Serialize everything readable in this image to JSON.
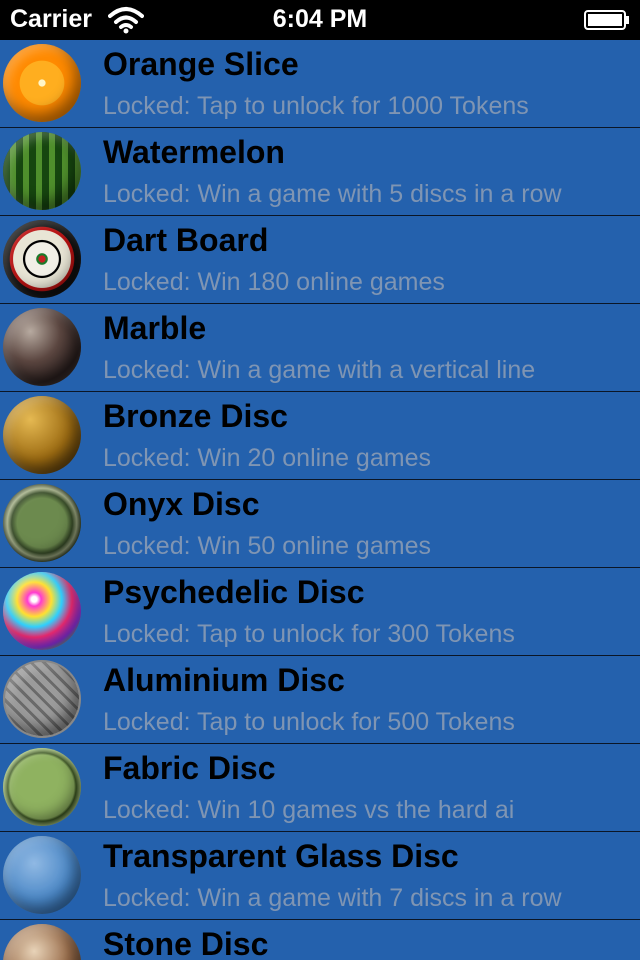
{
  "status_bar": {
    "carrier": "Carrier",
    "time": "6:04 PM",
    "wifi_icon": "wifi-icon",
    "battery_icon": "battery-icon"
  },
  "items": [
    {
      "title": "Orange Slice",
      "subtitle": "Locked: Tap to unlock for 1000 Tokens",
      "icon": "orange-slice-icon"
    },
    {
      "title": "Watermelon",
      "subtitle": "Locked: Win a game with 5 discs in a row",
      "icon": "watermelon-icon"
    },
    {
      "title": "Dart Board",
      "subtitle": "Locked: Win 180 online games",
      "icon": "dart-board-icon"
    },
    {
      "title": "Marble",
      "subtitle": "Locked: Win a game with a vertical line",
      "icon": "marble-icon"
    },
    {
      "title": "Bronze Disc",
      "subtitle": "Locked: Win 20 online games",
      "icon": "bronze-disc-icon"
    },
    {
      "title": "Onyx Disc",
      "subtitle": "Locked: Win 50 online games",
      "icon": "onyx-disc-icon"
    },
    {
      "title": "Psychedelic Disc",
      "subtitle": "Locked: Tap to unlock for 300 Tokens",
      "icon": "psychedelic-disc-icon"
    },
    {
      "title": "Aluminium Disc",
      "subtitle": "Locked: Tap to unlock for 500 Tokens",
      "icon": "aluminium-disc-icon"
    },
    {
      "title": "Fabric Disc",
      "subtitle": "Locked: Win 10 games vs the hard ai",
      "icon": "fabric-disc-icon"
    },
    {
      "title": "Transparent Glass Disc",
      "subtitle": "Locked: Win a game with 7 discs in a row",
      "icon": "glass-disc-icon"
    },
    {
      "title": "Stone Disc",
      "subtitle": "",
      "icon": "stone-disc-icon"
    }
  ],
  "colors": {
    "background": "#2461ad",
    "title_text": "#000000",
    "subtitle_text": "#7f95b3",
    "separator": "#0b1626"
  }
}
